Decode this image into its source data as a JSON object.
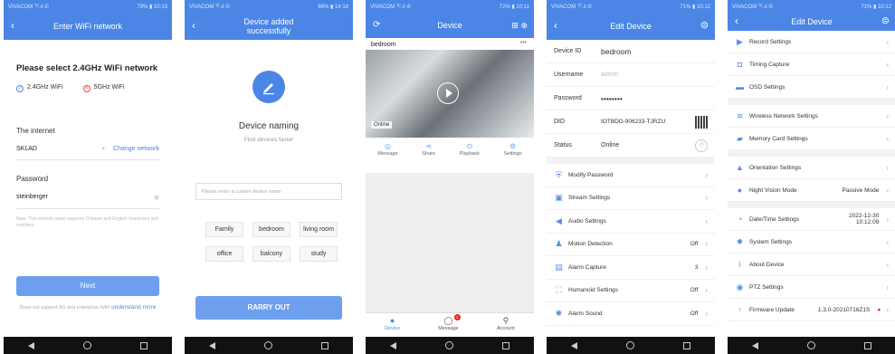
{
  "status": {
    "p1": {
      "left": "VIVACOM ᵀᴱ.ıl ✆",
      "right": "79% ▮ 10:13"
    },
    "p2": {
      "left": "VIVACOM ᵀᴱ.ıl ✆",
      "right": "86% ▮ 14:18"
    },
    "p3": {
      "left": "VIVACOM ᵀᴱ.ıl ✆",
      "right": "72% ▮ 10:11"
    },
    "p4": {
      "left": "VIVACOM ᵀᴱ.ıl ✆",
      "right": "71% ▮ 10:12"
    },
    "p5": {
      "left": "VIVACOM ᵀᴱ.ıl ✆",
      "right": "71% ▮ 10:12"
    }
  },
  "screen1": {
    "title": "Enter WiFi network",
    "heading": "Please select 2.4GHz WiFi network",
    "opt24": "2.4GHz WiFi",
    "opt5": "5GHz WiFi",
    "internet_label": "The internet",
    "ssid": "SKLAD",
    "change_network": "Change network",
    "password_label": "Password",
    "password": "steinberger",
    "note": "Note: The network name supports Chinese and English characters and numbers",
    "next": "Next",
    "foot": "Does not support 5G and enterprise WiFi",
    "understand": "understand more"
  },
  "screen2": {
    "title_line1": "Device added",
    "title_line2": "successfully",
    "naming": "Device naming",
    "find": "Find devices faster",
    "placeholder": "Please enter a custom device name",
    "chips": [
      "Family",
      "bedroom",
      "living room",
      "office",
      "balcony",
      "study"
    ],
    "carry_out": "RARRY OUT"
  },
  "screen3": {
    "title": "Device",
    "camera_name": "bedroom",
    "online": "Online",
    "actions": [
      {
        "icon": "message-icon",
        "glyph": "◎",
        "label": "Message"
      },
      {
        "icon": "share-icon",
        "glyph": "⋖",
        "label": "Share"
      },
      {
        "icon": "playback-icon",
        "glyph": "⊙",
        "label": "Playback"
      },
      {
        "icon": "settings-icon",
        "glyph": "⚙",
        "label": "Settings"
      }
    ],
    "tabs": [
      {
        "label": "Device",
        "glyph": "●"
      },
      {
        "label": "Message",
        "glyph": "◯",
        "badge": "1"
      },
      {
        "label": "Account",
        "glyph": "⚲"
      }
    ]
  },
  "screen4": {
    "title": "Edit Device",
    "device_id_label": "Device ID",
    "device_id": "bedroom",
    "username_label": "Username",
    "username": "admin",
    "password_label": "Password",
    "password": "••••••••",
    "did_label": "DID",
    "did": "IOTBDD-906233-TJRZU",
    "status_label": "Status",
    "status": "Online",
    "rows": [
      {
        "icon": "shield-icon",
        "glyph": "⛨",
        "label": "Modify Password",
        "value": ""
      },
      {
        "icon": "stream-icon",
        "glyph": "▣",
        "label": "Stream Settings",
        "value": ""
      },
      {
        "icon": "speaker-icon",
        "glyph": "◀",
        "label": "Audio Settings",
        "value": ""
      },
      {
        "icon": "bell-icon",
        "glyph": "♟",
        "label": "Motion Detection",
        "value": "Off"
      },
      {
        "icon": "capture-icon",
        "glyph": "▤",
        "label": "Alarm Capture",
        "value": "3"
      },
      {
        "icon": "humanoid-icon",
        "glyph": "⛶",
        "label": "Humanoid Settings",
        "value": "Off"
      },
      {
        "icon": "alarm-sound-icon",
        "glyph": "✺",
        "label": "Alarm Sound",
        "value": "Off"
      }
    ]
  },
  "screen5": {
    "title": "Edit Device",
    "groups": [
      [
        {
          "icon": "record-icon",
          "glyph": "▶",
          "label": "Record Settings",
          "value": ""
        },
        {
          "icon": "camera-icon",
          "glyph": "◘",
          "label": "Timing Capture",
          "value": ""
        },
        {
          "icon": "osd-icon",
          "glyph": "▬",
          "label": "OSD Settings",
          "value": ""
        }
      ],
      [
        {
          "icon": "wifi-icon",
          "glyph": "≋",
          "label": "Wireless Network Settings",
          "value": ""
        },
        {
          "icon": "memory-card-icon",
          "glyph": "▰",
          "label": "Memory Card Settings",
          "value": ""
        }
      ],
      [
        {
          "icon": "orientation-icon",
          "glyph": "▲",
          "label": "Orientation Settings",
          "value": ""
        },
        {
          "icon": "night-vision-icon",
          "glyph": "●",
          "label": "Night Vision Mode",
          "value": "Passive Mode"
        }
      ],
      [
        {
          "icon": "clock-icon",
          "glyph": "◔",
          "label": "Date/Time Settings",
          "value": "2022-12-30\n10:12:09"
        },
        {
          "icon": "gear-icon",
          "glyph": "✹",
          "label": "System Settings",
          "value": ""
        },
        {
          "icon": "info-icon",
          "glyph": "i",
          "label": "About Device",
          "value": ""
        },
        {
          "icon": "ptz-icon",
          "glyph": "◉",
          "label": "PTZ Settings",
          "value": ""
        },
        {
          "icon": "update-icon",
          "glyph": "↑",
          "label": "Firmware Update",
          "value": "1.3.0-20210716Z1S",
          "dot": "●"
        }
      ]
    ]
  },
  "colors": {
    "primary": "#4b86e6",
    "button": "#6d9fee",
    "alert": "#e22222"
  }
}
